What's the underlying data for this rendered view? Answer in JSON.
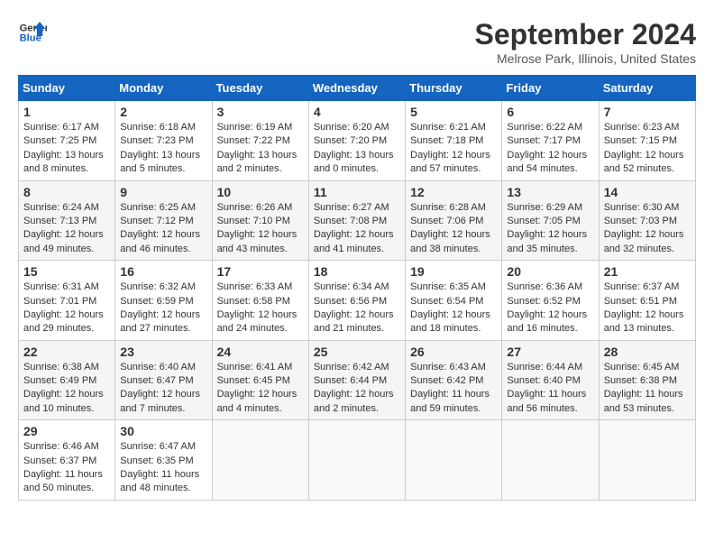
{
  "header": {
    "logo_line1": "General",
    "logo_line2": "Blue",
    "title": "September 2024",
    "subtitle": "Melrose Park, Illinois, United States"
  },
  "weekdays": [
    "Sunday",
    "Monday",
    "Tuesday",
    "Wednesday",
    "Thursday",
    "Friday",
    "Saturday"
  ],
  "weeks": [
    [
      {
        "day": "1",
        "sunrise": "6:17 AM",
        "sunset": "7:25 PM",
        "daylight": "13 hours and 8 minutes."
      },
      {
        "day": "2",
        "sunrise": "6:18 AM",
        "sunset": "7:23 PM",
        "daylight": "13 hours and 5 minutes."
      },
      {
        "day": "3",
        "sunrise": "6:19 AM",
        "sunset": "7:22 PM",
        "daylight": "13 hours and 2 minutes."
      },
      {
        "day": "4",
        "sunrise": "6:20 AM",
        "sunset": "7:20 PM",
        "daylight": "13 hours and 0 minutes."
      },
      {
        "day": "5",
        "sunrise": "6:21 AM",
        "sunset": "7:18 PM",
        "daylight": "12 hours and 57 minutes."
      },
      {
        "day": "6",
        "sunrise": "6:22 AM",
        "sunset": "7:17 PM",
        "daylight": "12 hours and 54 minutes."
      },
      {
        "day": "7",
        "sunrise": "6:23 AM",
        "sunset": "7:15 PM",
        "daylight": "12 hours and 52 minutes."
      }
    ],
    [
      {
        "day": "8",
        "sunrise": "6:24 AM",
        "sunset": "7:13 PM",
        "daylight": "12 hours and 49 minutes."
      },
      {
        "day": "9",
        "sunrise": "6:25 AM",
        "sunset": "7:12 PM",
        "daylight": "12 hours and 46 minutes."
      },
      {
        "day": "10",
        "sunrise": "6:26 AM",
        "sunset": "7:10 PM",
        "daylight": "12 hours and 43 minutes."
      },
      {
        "day": "11",
        "sunrise": "6:27 AM",
        "sunset": "7:08 PM",
        "daylight": "12 hours and 41 minutes."
      },
      {
        "day": "12",
        "sunrise": "6:28 AM",
        "sunset": "7:06 PM",
        "daylight": "12 hours and 38 minutes."
      },
      {
        "day": "13",
        "sunrise": "6:29 AM",
        "sunset": "7:05 PM",
        "daylight": "12 hours and 35 minutes."
      },
      {
        "day": "14",
        "sunrise": "6:30 AM",
        "sunset": "7:03 PM",
        "daylight": "12 hours and 32 minutes."
      }
    ],
    [
      {
        "day": "15",
        "sunrise": "6:31 AM",
        "sunset": "7:01 PM",
        "daylight": "12 hours and 29 minutes."
      },
      {
        "day": "16",
        "sunrise": "6:32 AM",
        "sunset": "6:59 PM",
        "daylight": "12 hours and 27 minutes."
      },
      {
        "day": "17",
        "sunrise": "6:33 AM",
        "sunset": "6:58 PM",
        "daylight": "12 hours and 24 minutes."
      },
      {
        "day": "18",
        "sunrise": "6:34 AM",
        "sunset": "6:56 PM",
        "daylight": "12 hours and 21 minutes."
      },
      {
        "day": "19",
        "sunrise": "6:35 AM",
        "sunset": "6:54 PM",
        "daylight": "12 hours and 18 minutes."
      },
      {
        "day": "20",
        "sunrise": "6:36 AM",
        "sunset": "6:52 PM",
        "daylight": "12 hours and 16 minutes."
      },
      {
        "day": "21",
        "sunrise": "6:37 AM",
        "sunset": "6:51 PM",
        "daylight": "12 hours and 13 minutes."
      }
    ],
    [
      {
        "day": "22",
        "sunrise": "6:38 AM",
        "sunset": "6:49 PM",
        "daylight": "12 hours and 10 minutes."
      },
      {
        "day": "23",
        "sunrise": "6:40 AM",
        "sunset": "6:47 PM",
        "daylight": "12 hours and 7 minutes."
      },
      {
        "day": "24",
        "sunrise": "6:41 AM",
        "sunset": "6:45 PM",
        "daylight": "12 hours and 4 minutes."
      },
      {
        "day": "25",
        "sunrise": "6:42 AM",
        "sunset": "6:44 PM",
        "daylight": "12 hours and 2 minutes."
      },
      {
        "day": "26",
        "sunrise": "6:43 AM",
        "sunset": "6:42 PM",
        "daylight": "11 hours and 59 minutes."
      },
      {
        "day": "27",
        "sunrise": "6:44 AM",
        "sunset": "6:40 PM",
        "daylight": "11 hours and 56 minutes."
      },
      {
        "day": "28",
        "sunrise": "6:45 AM",
        "sunset": "6:38 PM",
        "daylight": "11 hours and 53 minutes."
      }
    ],
    [
      {
        "day": "29",
        "sunrise": "6:46 AM",
        "sunset": "6:37 PM",
        "daylight": "11 hours and 50 minutes."
      },
      {
        "day": "30",
        "sunrise": "6:47 AM",
        "sunset": "6:35 PM",
        "daylight": "11 hours and 48 minutes."
      },
      null,
      null,
      null,
      null,
      null
    ]
  ]
}
